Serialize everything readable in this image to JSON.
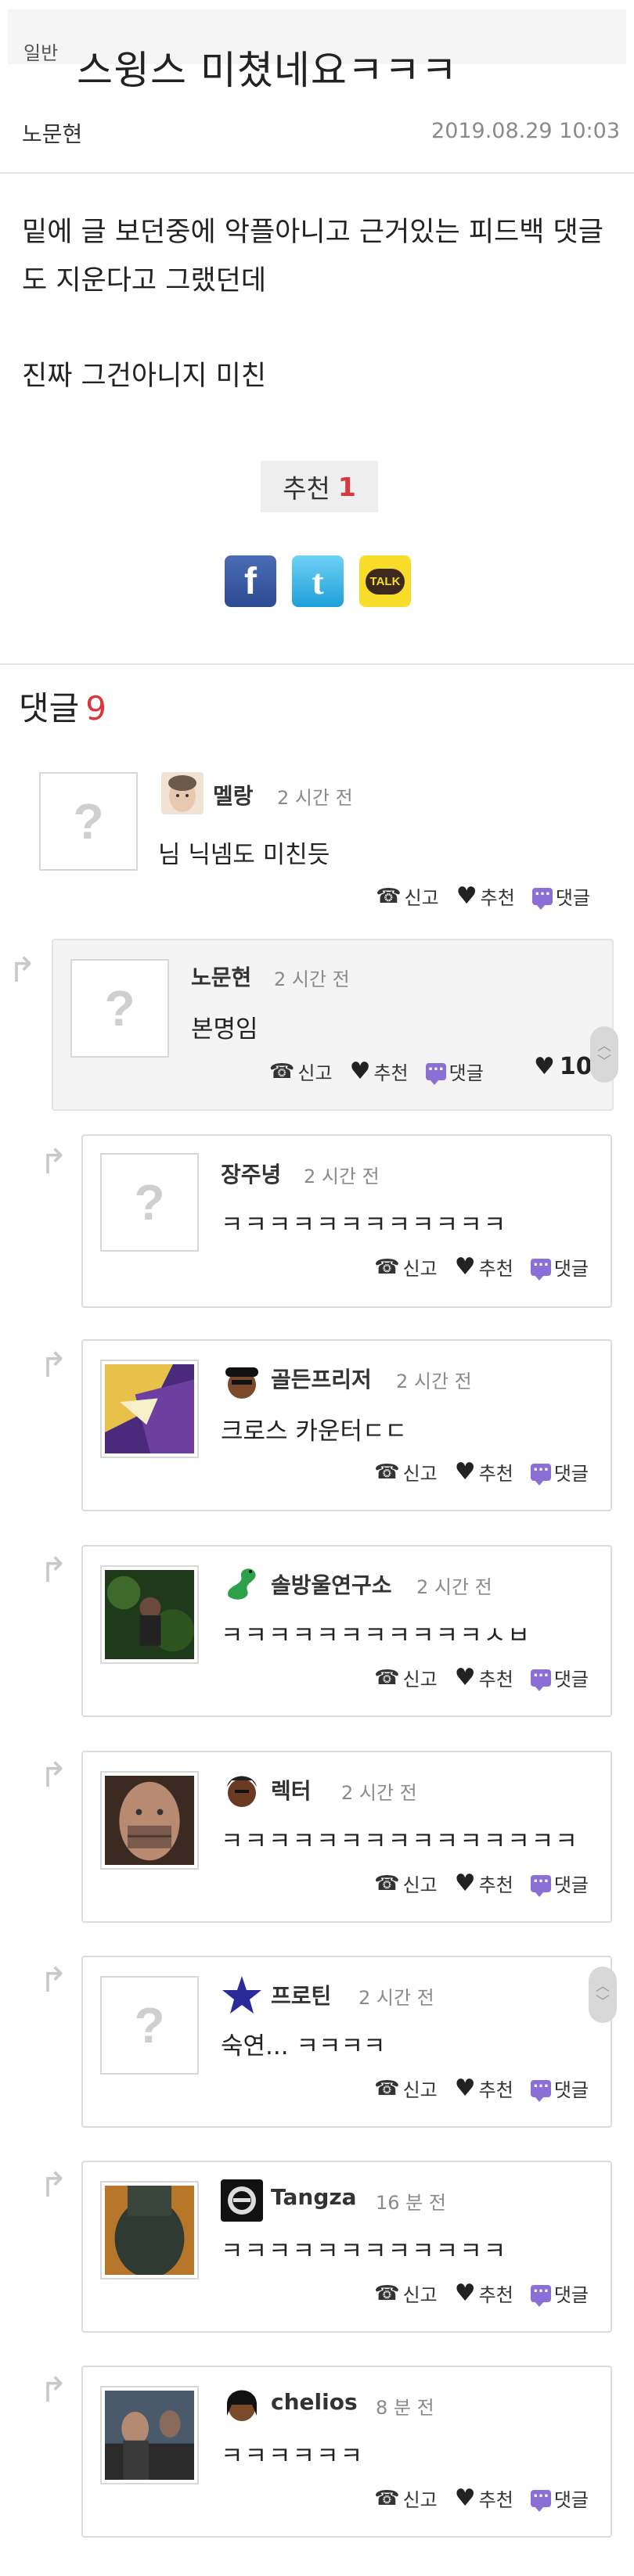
{
  "post": {
    "category": "일반",
    "title": "스윙스 미쳤네요ㅋㅋㅋ",
    "author": "노문현",
    "date": "2019.08.29 10:03",
    "body_line1": "밑에 글 보던중에 악플아니고 근거있는 피드백 댓글",
    "body_line2": "도 지운다고 그랬던데",
    "body_line3": "진짜 그건아니지 미친",
    "recommend_label": "추천",
    "recommend_count": "1",
    "share": {
      "facebook": "f",
      "twitter": "t",
      "kakao": "TALK"
    }
  },
  "comments_header": {
    "label": "댓글",
    "count": "9"
  },
  "actions": {
    "report": "신고",
    "recommend": "추천",
    "reply": "댓글"
  },
  "comments": [
    {
      "nick": "멜랑",
      "time": "2 시간 전",
      "text": "님 닉넴도 미친듯"
    },
    {
      "nick": "노문현",
      "time": "2 시간 전",
      "text": "본명임",
      "likes": "10"
    },
    {
      "nick": "장주녕",
      "time": "2 시간 전",
      "text": "ㅋㅋㅋㅋㅋㅋㅋㅋㅋㅋㅋㅋ"
    },
    {
      "nick": "골든프리저",
      "time": "2 시간 전",
      "text": "크로스 카운터ㄷㄷ"
    },
    {
      "nick": "솔방울연구소",
      "time": "2 시간 전",
      "text": "ㅋㅋㅋㅋㅋㅋㅋㅋㅋㅋㅋㅅㅂ"
    },
    {
      "nick": "렉터",
      "time": "2 시간 전",
      "text": "ㅋㅋㅋㅋㅋㅋㅋㅋㅋㅋㅋㅋㅋㅋㅋ"
    },
    {
      "nick": "프로틴",
      "time": "2 시간 전",
      "text": "숙연... ㅋㅋㅋㅋ"
    },
    {
      "nick": "Tangza",
      "time": "16 분 전",
      "text": "ㅋㅋㅋㅋㅋㅋㅋㅋㅋㅋㅋㅋ"
    },
    {
      "nick": "chelios",
      "time": "8 분 전",
      "text": "ㅋㅋㅋㅋㅋㅋ"
    }
  ]
}
